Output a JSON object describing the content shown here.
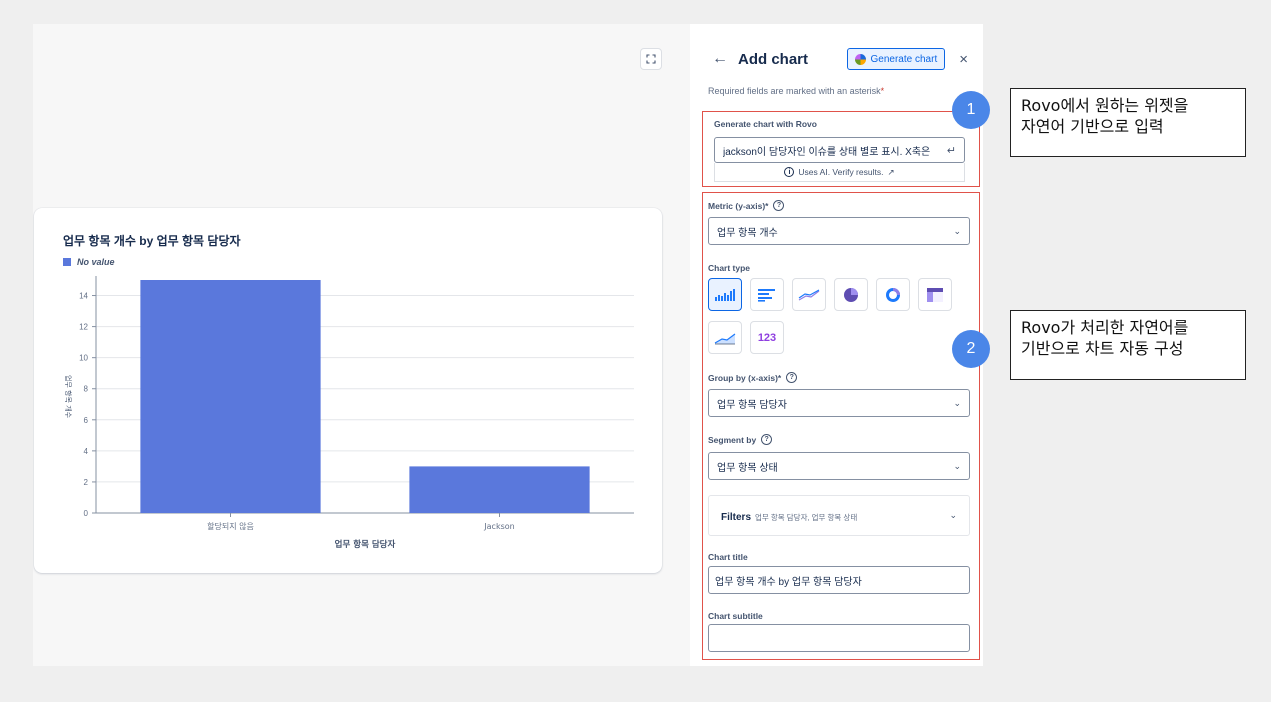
{
  "panel": {
    "back_label": "←",
    "title": "Add chart",
    "generate_button": "Generate chart",
    "close_label": "×",
    "required_note": "Required fields are marked with an asterisk",
    "required_mark": "*"
  },
  "rovo": {
    "label": "Generate chart with Rovo",
    "input_value": "jackson이 담당자인 이슈를 상태 별로 표시. X축은",
    "enter_glyph": "↵",
    "ai_note": "Uses AI. Verify results.",
    "external_glyph": "↗"
  },
  "metric": {
    "label": "Metric (y-axis)*",
    "value": "업무 항목 개수"
  },
  "chart_type": {
    "label": "Chart type",
    "options": [
      "vertical-bar",
      "horizontal-bar",
      "line",
      "pie",
      "donut",
      "heatmap",
      "area",
      "single-value"
    ],
    "selected": "vertical-bar",
    "single_value_text": "123"
  },
  "group_by": {
    "label": "Group by (x-axis)*",
    "value": "업무 항목 담당자"
  },
  "segment_by": {
    "label": "Segment by",
    "value": "업무 항목 상태"
  },
  "filters": {
    "label": "Filters",
    "value": "업무 항목 담당자, 업무 항목 상태"
  },
  "chart_title_field": {
    "label": "Chart title",
    "value": "업무 항목 개수 by 업무 항목 담당자"
  },
  "chart_subtitle_field": {
    "label": "Chart subtitle",
    "value": ""
  },
  "help_glyph": "?",
  "info_glyph": "i",
  "chevron_glyph": "⌄",
  "annotations": [
    {
      "number": "1",
      "text_line1": "Rovo에서 원하는 위젯을",
      "text_line2": "자연어 기반으로 입력"
    },
    {
      "number": "2",
      "text_line1": "Rovo가 처리한 자연어를",
      "text_line2": "기반으로 차트 자동 구성"
    }
  ],
  "colors": {
    "bar": "#5a78dc",
    "accent": "#0c66e4",
    "highlight": "#e0524a",
    "badge": "#4a86e8"
  },
  "chart_data": {
    "type": "bar",
    "title": "업무 항목 개수 by 업무 항목 담당자",
    "legend": [
      "No value"
    ],
    "categories": [
      "할당되지 않음",
      "Jackson"
    ],
    "series": [
      {
        "name": "No value",
        "values": [
          15,
          3
        ]
      }
    ],
    "xlabel": "업무 항목 담당자",
    "ylabel": "업무 항목 개수",
    "ylim": [
      0,
      15
    ],
    "yticks": [
      0,
      2,
      4,
      6,
      8,
      10,
      12,
      14
    ],
    "grid": true,
    "legend_position": "top-left"
  }
}
